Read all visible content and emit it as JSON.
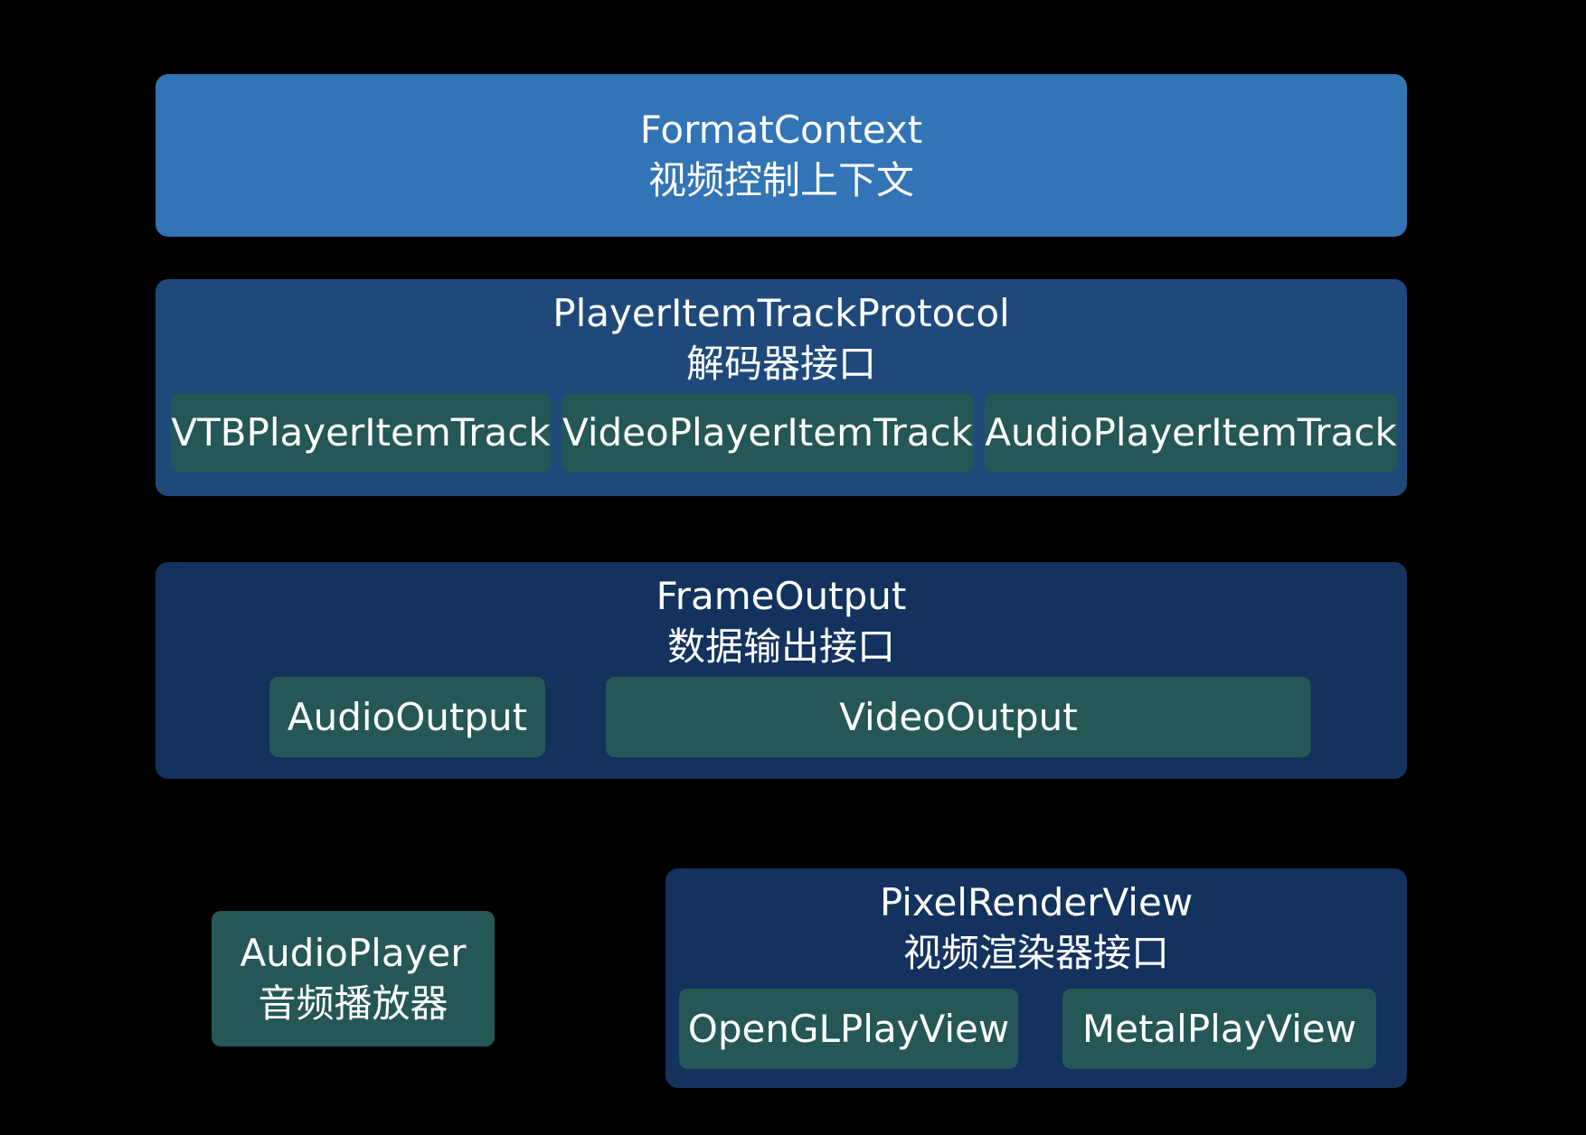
{
  "colors": {
    "background": "#000000",
    "format_context": "#3274b5",
    "track_protocol": "#1f497a",
    "frame_output": "#13325e",
    "render_view": "#13325e",
    "component": "#245756",
    "text": "#ffffff"
  },
  "format_context": {
    "name": "FormatContext",
    "desc": "视频控制上下文"
  },
  "track_protocol": {
    "name": "PlayerItemTrackProtocol",
    "desc": "解码器接口",
    "items": [
      "VTBPlayerItemTrack",
      "VideoPlayerItemTrack",
      "AudioPlayerItemTrack"
    ]
  },
  "frame_output": {
    "name": "FrameOutput",
    "desc": "数据输出接口",
    "items": [
      "AudioOutput",
      "VideoOutput"
    ]
  },
  "audio_player": {
    "name": "AudioPlayer",
    "desc": "音频播放器"
  },
  "render_view": {
    "name": "PixelRenderView",
    "desc": "视频渲染器接口",
    "items": [
      "OpenGLPlayView",
      "MetalPlayView"
    ]
  }
}
